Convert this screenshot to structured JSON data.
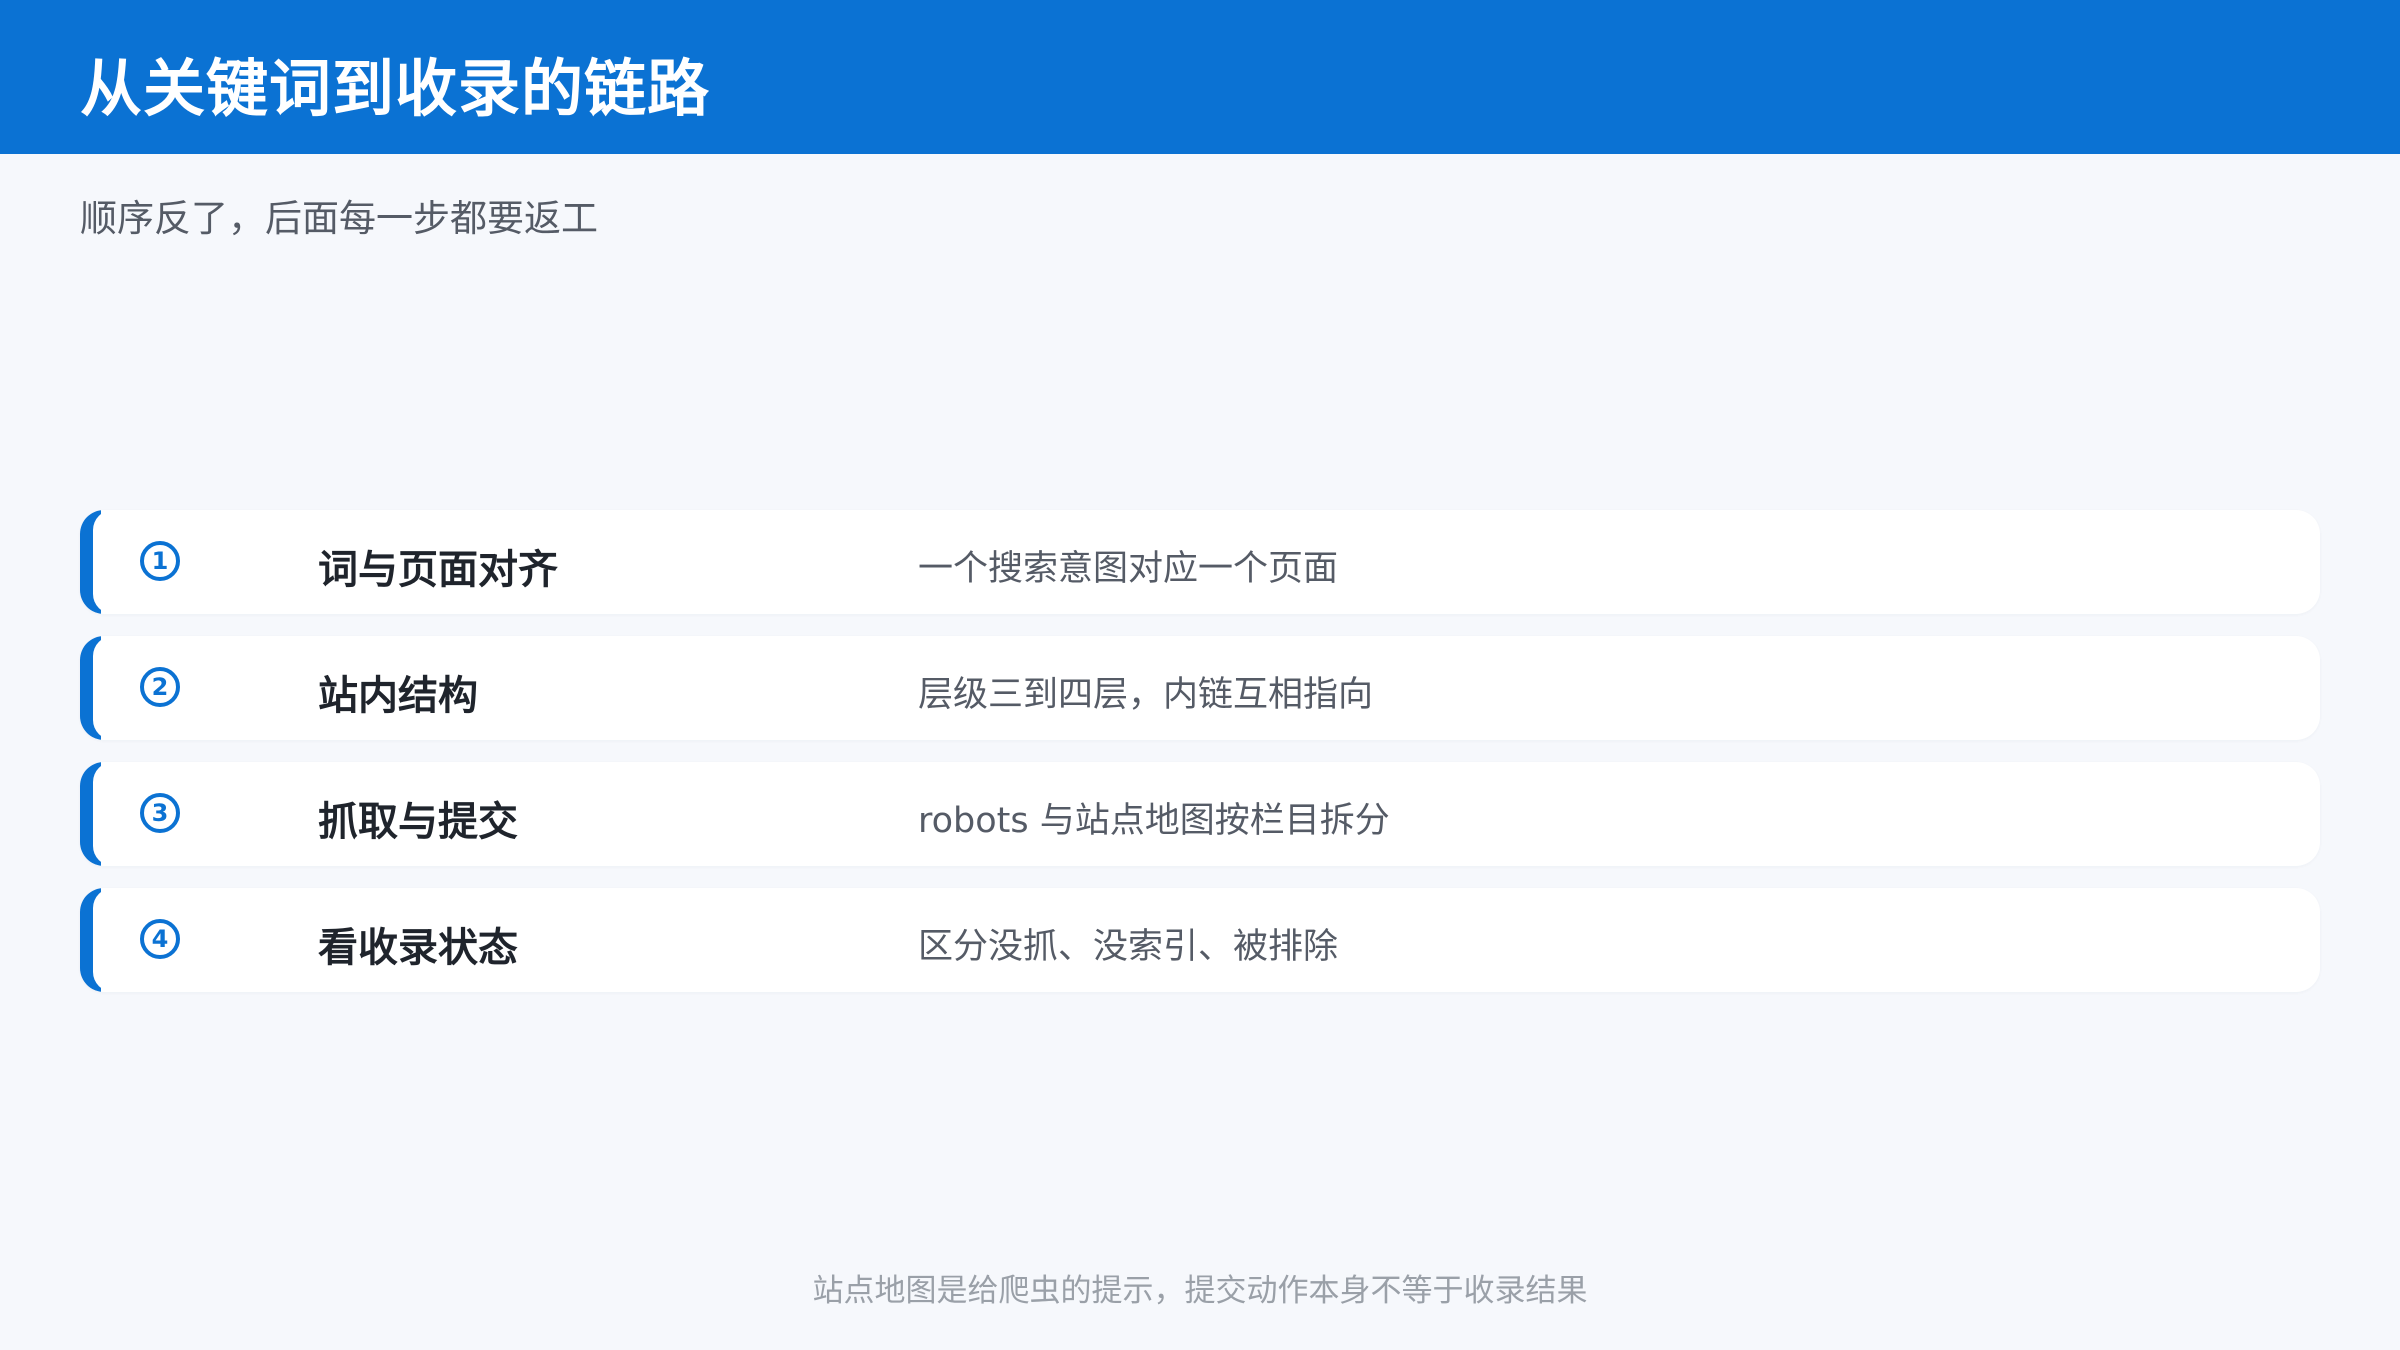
{
  "slide": {
    "title": "从关键词到收录的链路",
    "subtitle": "顺序反了，后面每一步都要返工",
    "steps": [
      {
        "number": "1",
        "label": "词与页面对齐",
        "description": "一个搜索意图对应一个页面"
      },
      {
        "number": "2",
        "label": "站内结构",
        "description": "层级三到四层，内链互相指向"
      },
      {
        "number": "3",
        "label": "抓取与提交",
        "description": "robots 与站点地图按栏目拆分"
      },
      {
        "number": "4",
        "label": "看收录状态",
        "description": "区分没抓、没索引、被排除"
      }
    ],
    "footer": "站点地图是给爬虫的提示，提交动作本身不等于收录结果"
  },
  "colors": {
    "accent": "#0b72d3",
    "background": "#f6f8fc",
    "card": "#ffffff",
    "label_text": "#1f242c",
    "body_text": "#555b66",
    "footer_text": "#9aa0a8"
  }
}
